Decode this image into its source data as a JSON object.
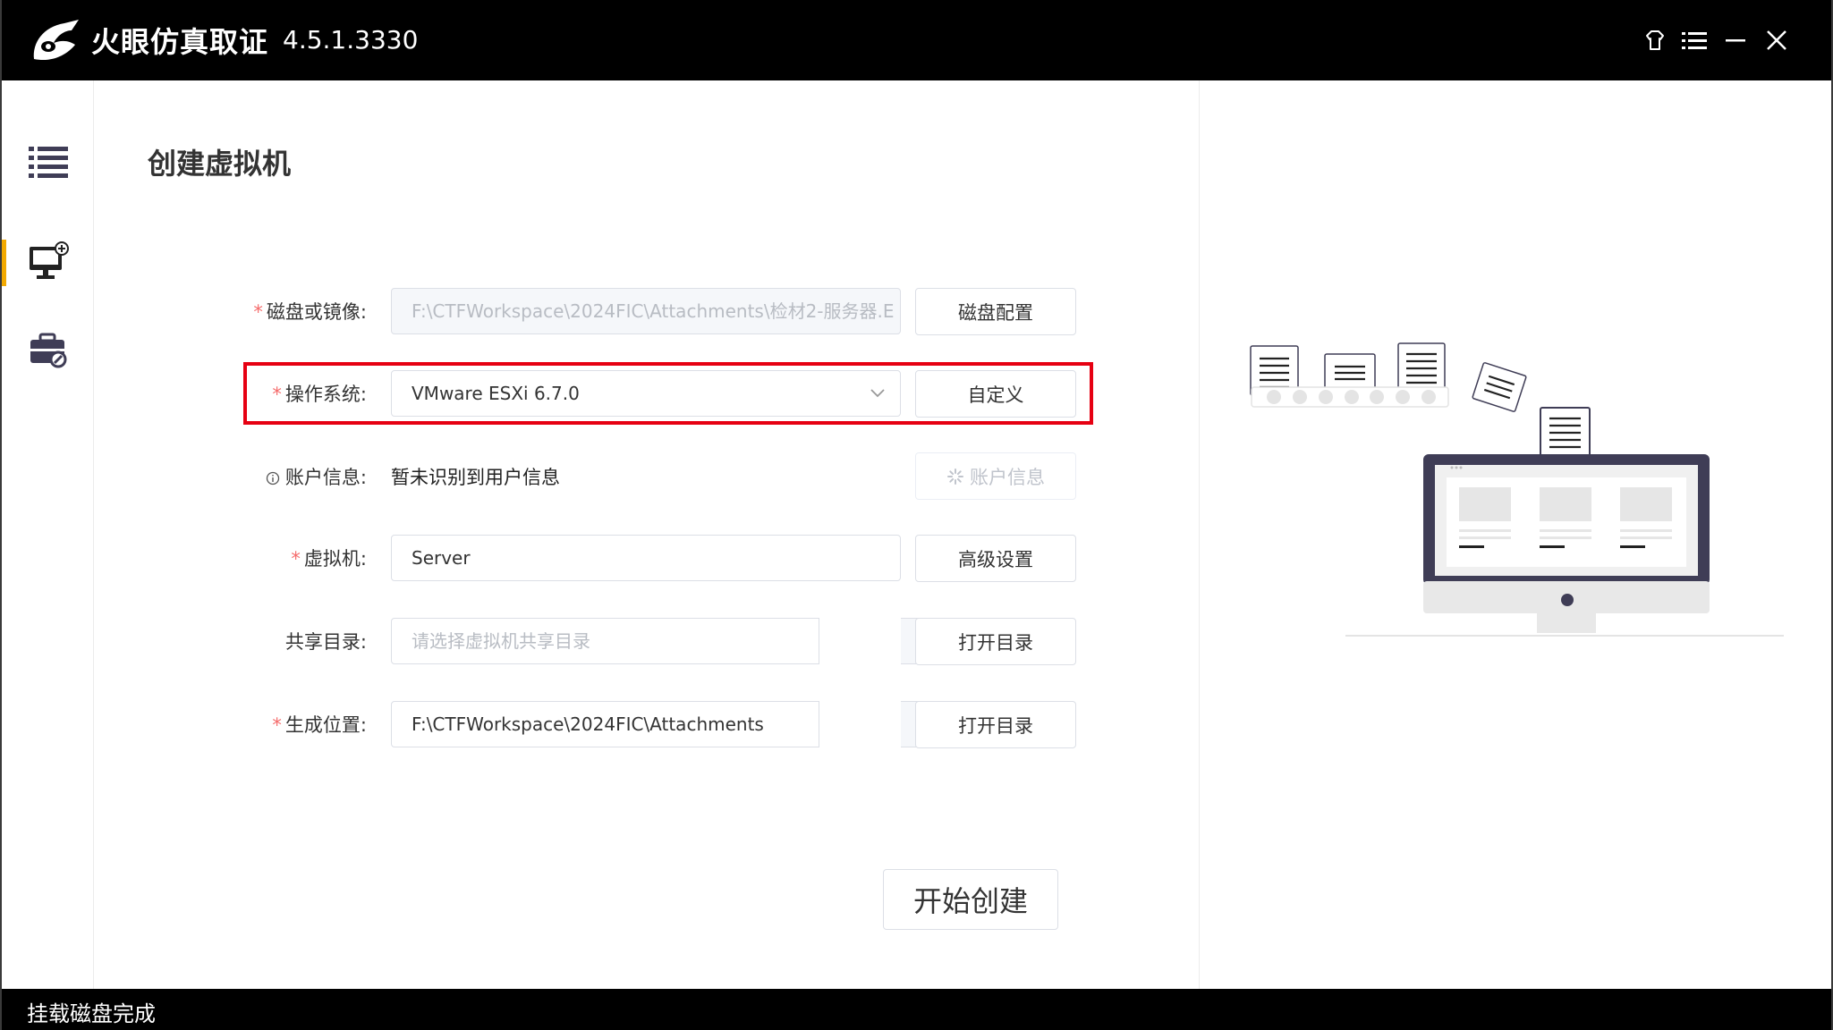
{
  "app": {
    "name": "火眼仿真取证",
    "version": "4.5.1.3330"
  },
  "window_controls": [
    "skin-icon",
    "menu-icon",
    "minimize-icon",
    "close-icon"
  ],
  "sidebar": {
    "items": [
      {
        "icon": "list-icon",
        "active": false
      },
      {
        "icon": "monitor-add-icon",
        "active": true
      },
      {
        "icon": "toolbox-icon",
        "active": false
      }
    ]
  },
  "page": {
    "title": "创建虚拟机"
  },
  "form": {
    "disk": {
      "label": "磁盘或镜像:",
      "value": "F:\\CTFWorkspace\\2024FIC\\Attachments\\检材2-服务器.E",
      "button": "磁盘配置"
    },
    "os": {
      "label": "操作系统:",
      "value": "VMware ESXi 6.7.0",
      "button": "自定义"
    },
    "account": {
      "label": "账户信息:",
      "value": "暂未识别到用户信息",
      "button": "账户信息"
    },
    "vm": {
      "label": "虚拟机:",
      "value": "Server",
      "button": "高级设置"
    },
    "share": {
      "label": "共享目录:",
      "placeholder": "请选择虚拟机共享目录",
      "button": "打开目录"
    },
    "output": {
      "label": "生成位置:",
      "value": "F:\\CTFWorkspace\\2024FIC\\Attachments",
      "button": "打开目录"
    }
  },
  "start_button": "开始创建",
  "status": {
    "text": "挂载磁盘完成"
  },
  "colors": {
    "accent_highlight": "#e60012",
    "required": "#f56c6c",
    "titlebar": "#000000",
    "active_indicator": "#f2a900",
    "illustration_monitor": "#3f3d56"
  }
}
